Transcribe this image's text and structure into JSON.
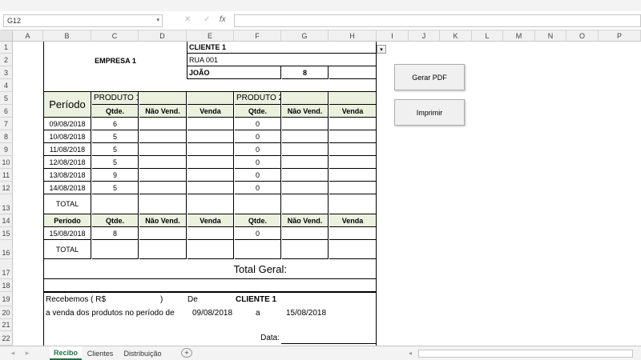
{
  "name_box": "G12",
  "formula_icons": {
    "cancel": "✕",
    "enter": "✓",
    "fx": "fx"
  },
  "columns": [
    "A",
    "B",
    "C",
    "D",
    "E",
    "F",
    "G",
    "H",
    "I",
    "J",
    "K",
    "L",
    "M",
    "N",
    "O",
    "P"
  ],
  "rows": [
    "1",
    "2",
    "3",
    "4",
    "5",
    "6",
    "7",
    "8",
    "9",
    "10",
    "11",
    "12",
    "13",
    "14",
    "15",
    "16",
    "17",
    "18",
    "19",
    "20",
    "21",
    "22"
  ],
  "sheet": {
    "empresa": "EMPRESA 1",
    "cliente": "CLIENTE 1",
    "rua": "RUA 001",
    "joao": "JOÃO",
    "numero": "8",
    "periodo_header": "Período",
    "produto1": "PRODUTO 1",
    "produto2": "PRODUTO 2",
    "qtde": "Qtde.",
    "nao_vend": "Não Vend.",
    "venda": "Venda",
    "rows": [
      {
        "date": "09/08/2018",
        "p1": "6",
        "p2": "0"
      },
      {
        "date": "10/08/2018",
        "p1": "5",
        "p2": "0"
      },
      {
        "date": "11/08/2018",
        "p1": "5",
        "p2": "0"
      },
      {
        "date": "12/08/2018",
        "p1": "5",
        "p2": "0"
      },
      {
        "date": "13/08/2018",
        "p1": "9",
        "p2": "0"
      },
      {
        "date": "14/08/2018",
        "p1": "5",
        "p2": "0"
      }
    ],
    "total": "TOTAL",
    "periodo2": "Período",
    "row2": {
      "date": "15/08/2018",
      "p1": "8",
      "p2": "0"
    },
    "total2": "TOTAL",
    "total_geral": "Total Geral:",
    "recebemos": "Recebemos   ( R$",
    "paren": ")",
    "de": "De",
    "cliente_receipt": "CLIENTE 1",
    "venda_text": "a venda dos produtos no período de",
    "date_from": "09/08/2018",
    "a": "a",
    "date_to": "15/08/2018",
    "data_label": "Data:"
  },
  "buttons": {
    "gerar_pdf": "Gerar PDF",
    "imprimir": "Imprimir"
  },
  "tabs": [
    "Recibo",
    "Clientes",
    "Distribuição"
  ],
  "add_sheet": "+"
}
